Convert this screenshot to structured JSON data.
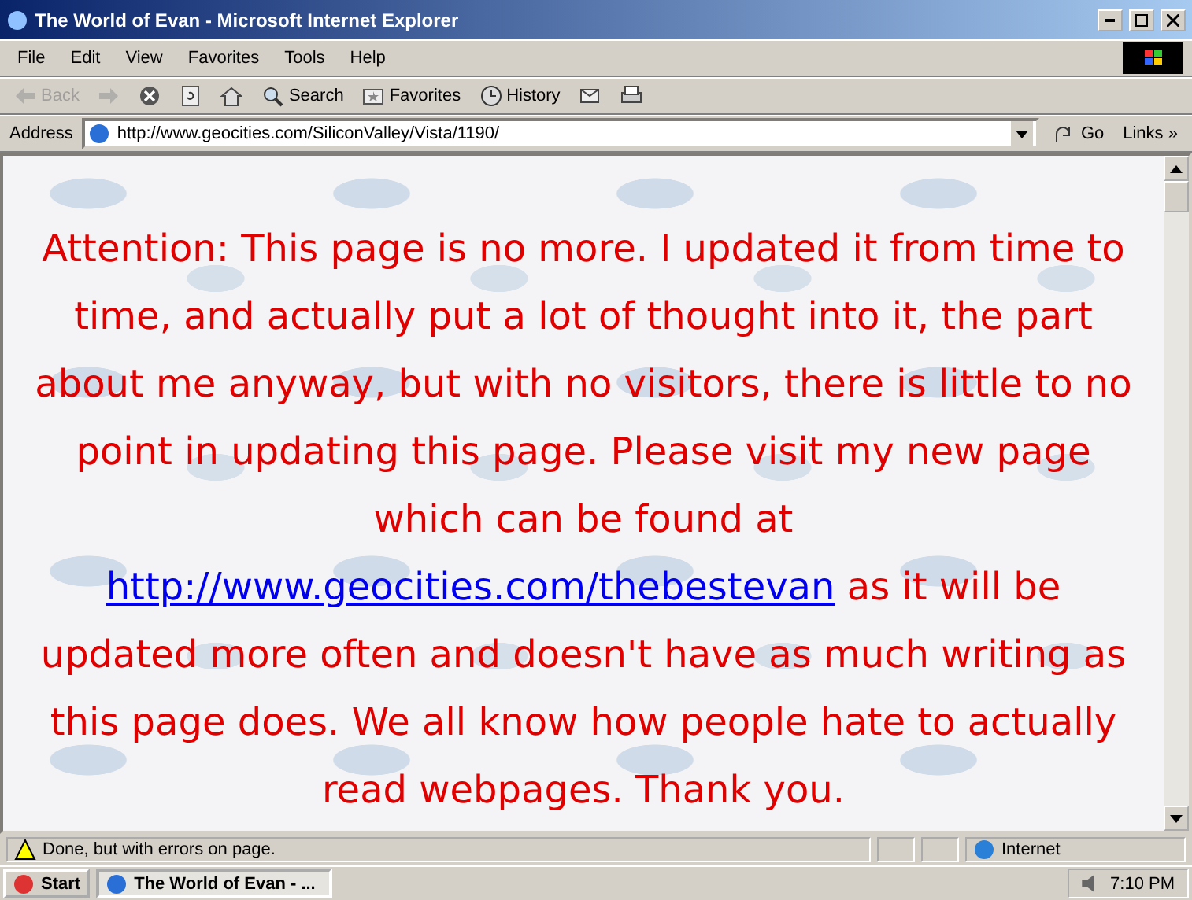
{
  "window": {
    "title": "The World of Evan - Microsoft Internet Explorer"
  },
  "menu": {
    "items": [
      "File",
      "Edit",
      "View",
      "Favorites",
      "Tools",
      "Help"
    ]
  },
  "toolbar": {
    "buttons": [
      {
        "kind": "back",
        "label": "Back",
        "disabled": true
      },
      {
        "kind": "forward",
        "disabled": true
      },
      {
        "kind": "stop",
        "disabled": false
      },
      {
        "kind": "refresh",
        "disabled": false
      },
      {
        "kind": "home",
        "disabled": false
      },
      {
        "kind": "search",
        "label": "Search",
        "disabled": false
      },
      {
        "kind": "favorites",
        "label": "Favorites",
        "disabled": false
      },
      {
        "kind": "history",
        "label": "History",
        "disabled": false
      },
      {
        "kind": "mail",
        "disabled": false
      },
      {
        "kind": "print",
        "disabled": false
      }
    ]
  },
  "address": {
    "label": "Address",
    "value": "http://www.geocities.com/SiliconValley/Vista/1190/",
    "go": "Go",
    "links": "Links",
    "links_more": "»"
  },
  "content": {
    "text_before": "Attention: This page is no more. I updated it from time to time, and actually put a lot of thought into it, the part about me anyway, but with no visitors, there is little to no point in updating this page. Please visit my new page which can be found at",
    "link": "http://www.geocities.com/thebestevan",
    "text_after": "as it will be updated more often and doesn't have as much writing as this page does. We all know how people hate to actually read webpages. Thank you."
  },
  "status_bar": {
    "text": "Done, but with errors on page.",
    "zone": "Internet"
  },
  "taskbar": {
    "start": "Start",
    "tasks": [
      {
        "label": "The World of Evan - ...",
        "selected": true
      }
    ],
    "clock": "7:10 PM"
  }
}
